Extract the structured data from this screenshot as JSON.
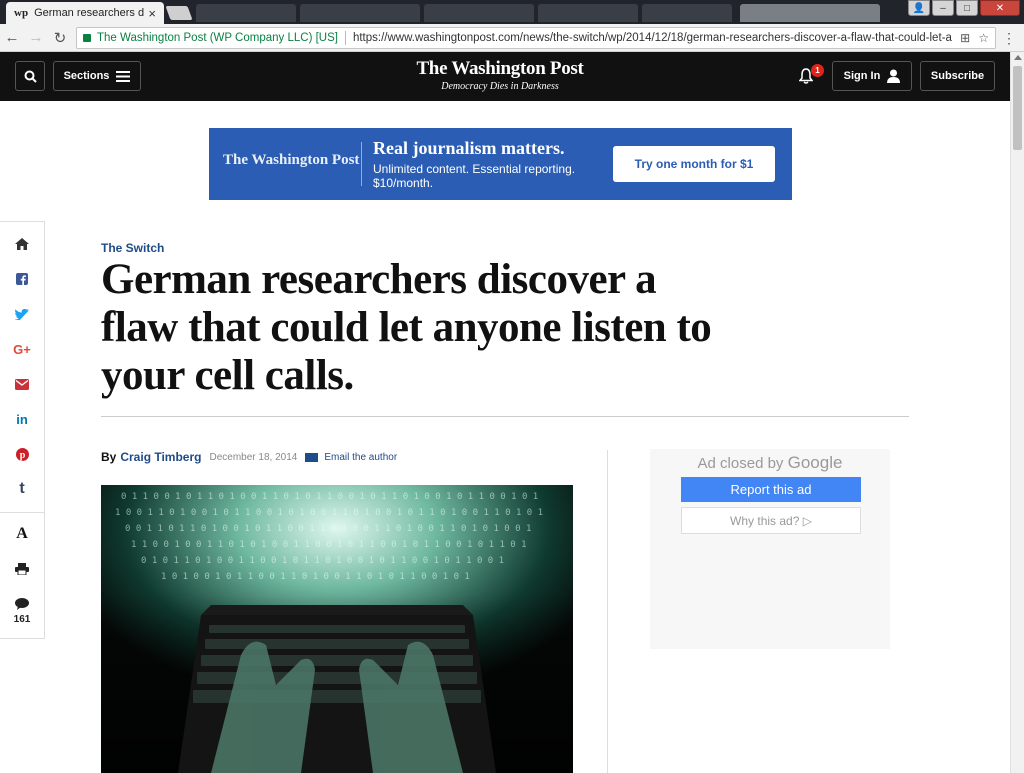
{
  "browser": {
    "tab_title": "German researchers disc",
    "tab_favicon": "wp",
    "tab_close": "×",
    "security_label": "The Washington Post (WP Company LLC) [US]",
    "url": "https://www.washingtonpost.com/news/the-switch/wp/2014/12/18/german-researchers-discover-a-flaw-that-could-let-an..."
  },
  "header": {
    "sections_label": "Sections",
    "logo": "The Washington Post",
    "tagline": "Democracy Dies in Darkness",
    "notification_count": "1",
    "signin_label": "Sign In",
    "subscribe_label": "Subscribe"
  },
  "banner": {
    "logo": "The Washington Post",
    "headline": "Real journalism matters.",
    "subtext": "Unlimited content. Essential reporting. $10/month.",
    "cta": "Try one month for $1",
    "color": "#2a5db3"
  },
  "share_rail": {
    "items": [
      "home-icon",
      "facebook-icon",
      "twitter-icon",
      "google-plus-icon",
      "email-icon",
      "linkedin-icon",
      "pinterest-icon",
      "tumblr-icon",
      "font-size-icon",
      "print-icon",
      "comments-icon"
    ],
    "google_plus": "G+",
    "linkedin": "in",
    "tumblr": "t",
    "font_size": "A",
    "comment_count": "161"
  },
  "article": {
    "kicker": "The Switch",
    "headline": "German researchers discover a flaw that could let anyone listen to your cell calls.",
    "byline_prefix": "By",
    "author": "Craig Timberg",
    "date": "December 18, 2014",
    "email_author": "Email the author"
  },
  "ad": {
    "closed_by": "Ad closed by",
    "google": "Google",
    "report": "Report this ad",
    "why": "Why this ad? ▷"
  }
}
